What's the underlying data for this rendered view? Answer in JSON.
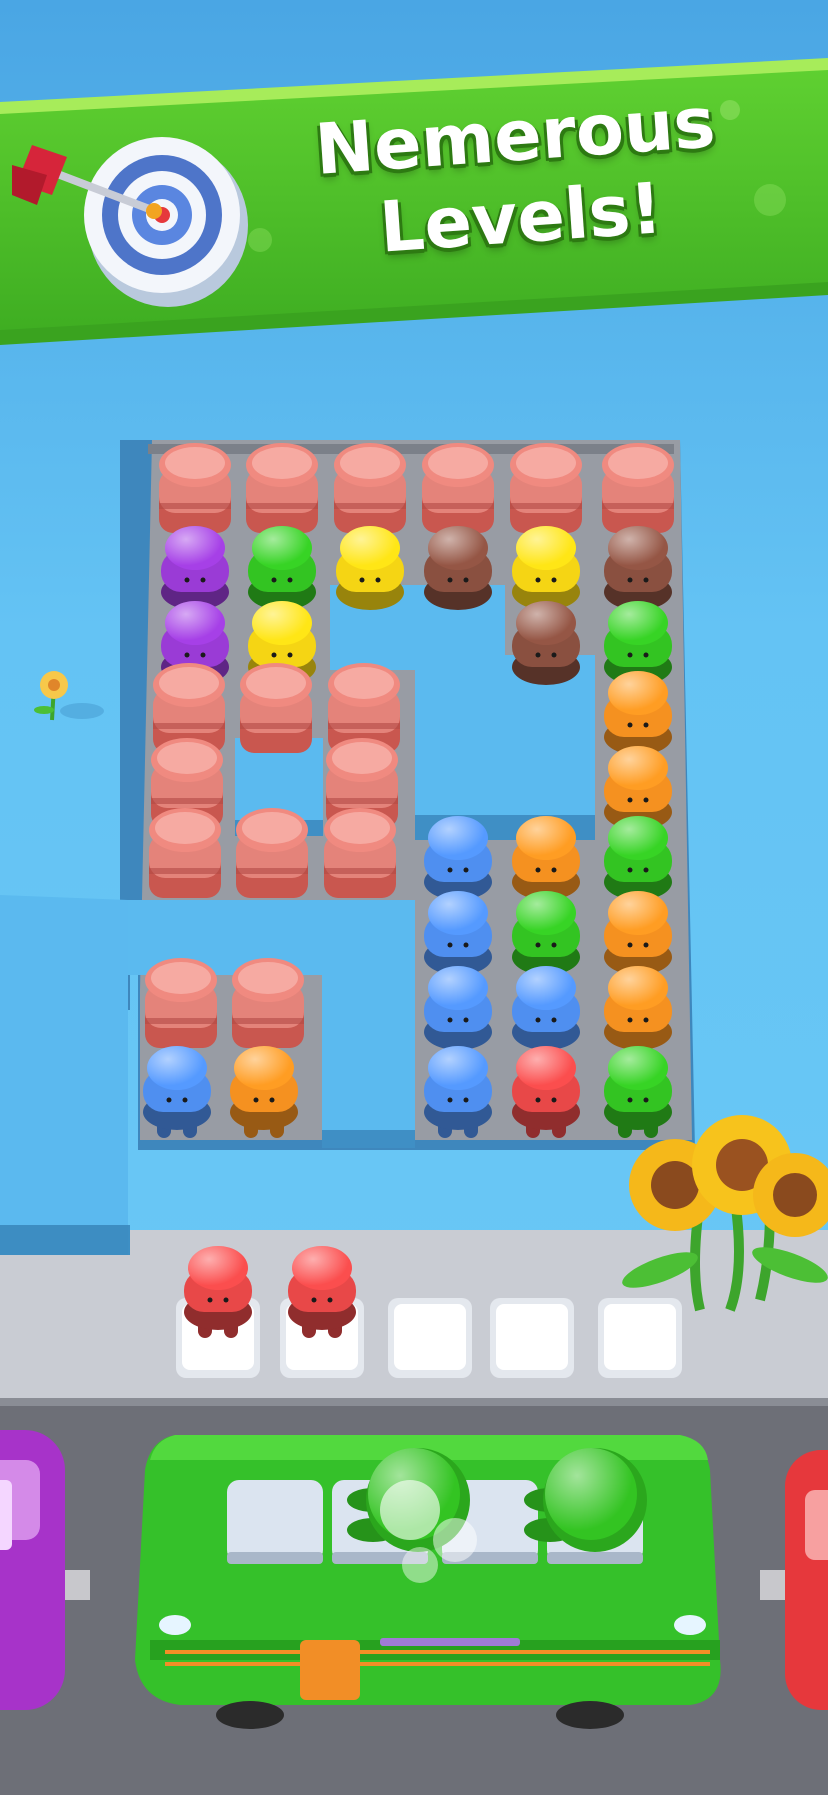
{
  "banner": {
    "title_line1": "Nemerous",
    "title_line2": "Levels!",
    "icon": "dart-target-icon"
  },
  "colors": {
    "sky": "#57b5ec",
    "banner_green": "#4fc02a",
    "board": "#8e949c",
    "road": "#6e7078",
    "jar": "#f08a80",
    "purple": "#9a3bd6",
    "green": "#33c422",
    "yellow": "#f5d514",
    "brown": "#8a5040",
    "orange": "#f59120",
    "blue": "#4f8ff0",
    "red": "#e84848"
  },
  "grid": [
    [
      "jar",
      "jar",
      "jar",
      "jar",
      "jar",
      "jar"
    ],
    [
      "purple",
      "green",
      "yellow",
      "brown",
      "yellow",
      "brown"
    ],
    [
      "purple",
      "yellow",
      "",
      "",
      "brown",
      "green"
    ],
    [
      "jar",
      "jar",
      "jar",
      "",
      "",
      "orange"
    ],
    [
      "jar",
      "",
      "jar",
      "",
      "",
      "orange"
    ],
    [
      "jar",
      "jar",
      "jar",
      "blue",
      "orange",
      "green"
    ],
    [
      "",
      "",
      "",
      "blue",
      "green",
      "orange"
    ],
    [
      "jar",
      "jar",
      "",
      "blue",
      "blue",
      "orange"
    ],
    [
      "blue",
      "orange",
      "",
      "blue",
      "red",
      "green"
    ]
  ],
  "queue_slots": [
    "red",
    "red",
    "",
    "",
    ""
  ],
  "bus": {
    "color": "green",
    "seats_filled": 2,
    "seats_total": 4
  },
  "side_cars": [
    "purple",
    "red"
  ],
  "decorations": [
    "daisy-flower-icon",
    "sunflower-icon"
  ]
}
